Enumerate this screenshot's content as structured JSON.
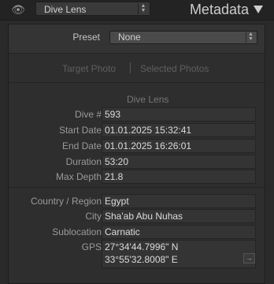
{
  "top": {
    "preset_value": "Dive Lens",
    "panel_title": "Metadata"
  },
  "preset": {
    "label": "Preset",
    "value": "None"
  },
  "target": {
    "target_photo": "Target Photo",
    "selected_photos": "Selected Photos"
  },
  "section_title": "Dive Lens",
  "fields": [
    {
      "label": "Dive #",
      "value": "593"
    },
    {
      "label": "Start Date",
      "value": "01.01.2025 15:32:41"
    },
    {
      "label": "End Date",
      "value": "01.01.2025 16:26:01"
    },
    {
      "label": "Duration",
      "value": "53:20"
    },
    {
      "label": "Max Depth",
      "value": "21.8"
    }
  ],
  "location": [
    {
      "label": "Country / Region",
      "value": "Egypt"
    },
    {
      "label": "City",
      "value": "Sha'ab Abu Nuhas"
    },
    {
      "label": "Sublocation",
      "value": "Carnatic"
    }
  ],
  "gps": {
    "label": "GPS",
    "line1": "27°34'44.7996\" N",
    "line2": "33°55'32.8008\" E"
  },
  "icons": {
    "eye": "eye-icon",
    "collapse": "triangle-down-icon",
    "stepper": "up-down-arrows-icon",
    "gps_button": "arrow-right-icon"
  }
}
